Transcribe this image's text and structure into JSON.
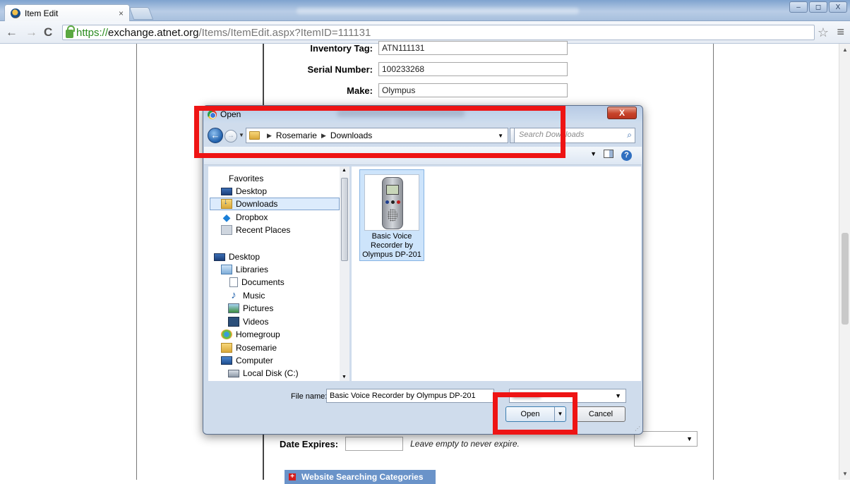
{
  "browser": {
    "tab_title": "Item Edit",
    "tab_close": "×",
    "url_scheme": "https://",
    "url_host": "exchange.atnet.org",
    "url_path": "/Items/ItemEdit.aspx?ItemID=111131",
    "window_buttons": [
      "–",
      "◻",
      "X"
    ]
  },
  "form": {
    "inventory_tag_label": "Inventory Tag:",
    "inventory_tag_value": "ATN111131",
    "serial_number_label": "Serial Number:",
    "serial_number_value": "100233268",
    "make_label": "Make:",
    "make_value": "Olympus",
    "date_expires_label": "Date Expires:",
    "date_expires_value": "",
    "date_expires_hint": "Leave empty to never expire.",
    "category_button": "Website Searching Categories"
  },
  "dialog": {
    "title": "Open",
    "close": "X",
    "breadcrumb": [
      "Rosemarie",
      "Downloads"
    ],
    "search_placeholder": "Search Downloads",
    "nav": {
      "favorites": "Favorites",
      "desktop": "Desktop",
      "downloads": "Downloads",
      "dropbox": "Dropbox",
      "recent_places": "Recent Places",
      "desktop_root": "Desktop",
      "libraries": "Libraries",
      "documents": "Documents",
      "music": "Music",
      "pictures": "Pictures",
      "videos": "Videos",
      "homegroup": "Homegroup",
      "rosemarie": "Rosemarie",
      "computer": "Computer",
      "local_disk": "Local Disk (C:)"
    },
    "file": {
      "name": "Basic Voice Recorder by Olympus DP-201"
    },
    "filename_label": "File name:",
    "filename_value": "Basic Voice Recorder by Olympus DP-201",
    "open_button": "Open",
    "cancel_button": "Cancel"
  },
  "colors": {
    "highlight": "#ee1414",
    "category_bar": "#6a93c9",
    "url_green": "#2a8c1f"
  }
}
